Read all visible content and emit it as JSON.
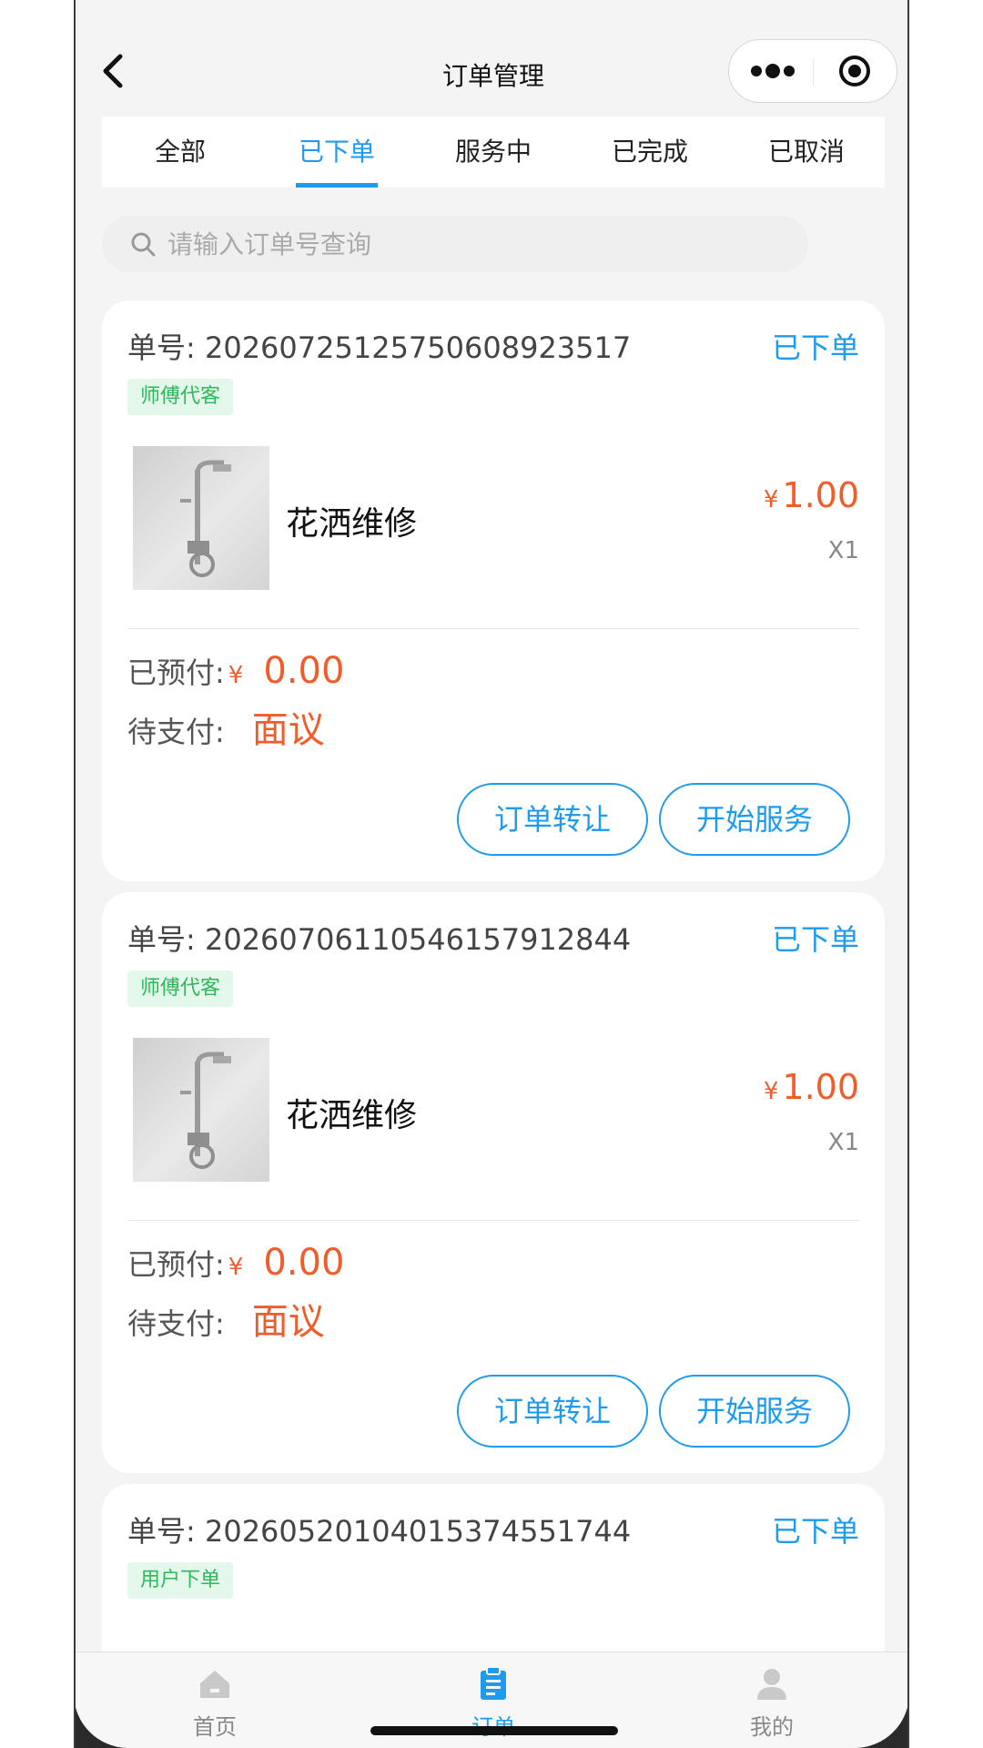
{
  "navbar": {
    "title": "订单管理",
    "back_icon": "chevron-left-icon",
    "more_icon": "more-dots-icon",
    "close_icon": "target-close-icon"
  },
  "tabs": [
    {
      "label": "全部",
      "active": false
    },
    {
      "label": "已下单",
      "active": true
    },
    {
      "label": "服务中",
      "active": false
    },
    {
      "label": "已完成",
      "active": false
    },
    {
      "label": "已取消",
      "active": false
    }
  ],
  "search": {
    "placeholder": "请输入订单号查询",
    "icon": "search-icon"
  },
  "orders": [
    {
      "order_label": "单号:",
      "order_no": "20260725125750608923517",
      "status": "已下单",
      "tag": "师傅代客",
      "product_name": "花洒维修",
      "price_symbol": "¥",
      "price": "1.00",
      "quantity": "X1",
      "prepaid_label": "已预付:",
      "prepaid_symbol": "¥",
      "prepaid_amount": "0.00",
      "pending_label": "待支付:",
      "pending_value": "面议",
      "buttons": [
        "订单转让",
        "开始服务"
      ]
    },
    {
      "order_label": "单号:",
      "order_no": "20260706110546157912844",
      "status": "已下单",
      "tag": "师傅代客",
      "product_name": "花洒维修",
      "price_symbol": "¥",
      "price": "1.00",
      "quantity": "X1",
      "prepaid_label": "已预付:",
      "prepaid_symbol": "¥",
      "prepaid_amount": "0.00",
      "pending_label": "待支付:",
      "pending_value": "面议",
      "buttons": [
        "订单转让",
        "开始服务"
      ]
    },
    {
      "order_label": "单号:",
      "order_no": "20260520104015374551744",
      "status": "已下单",
      "tag": "用户下单"
    }
  ],
  "tabbar": [
    {
      "label": "首页",
      "icon": "home-icon",
      "active": false
    },
    {
      "label": "订单",
      "icon": "order-clipboard-icon",
      "active": true
    },
    {
      "label": "我的",
      "icon": "user-icon",
      "active": false
    }
  ],
  "colors": {
    "accent": "#1e9bef",
    "price": "#f25c2a",
    "tag_green": "#2eb85c"
  }
}
